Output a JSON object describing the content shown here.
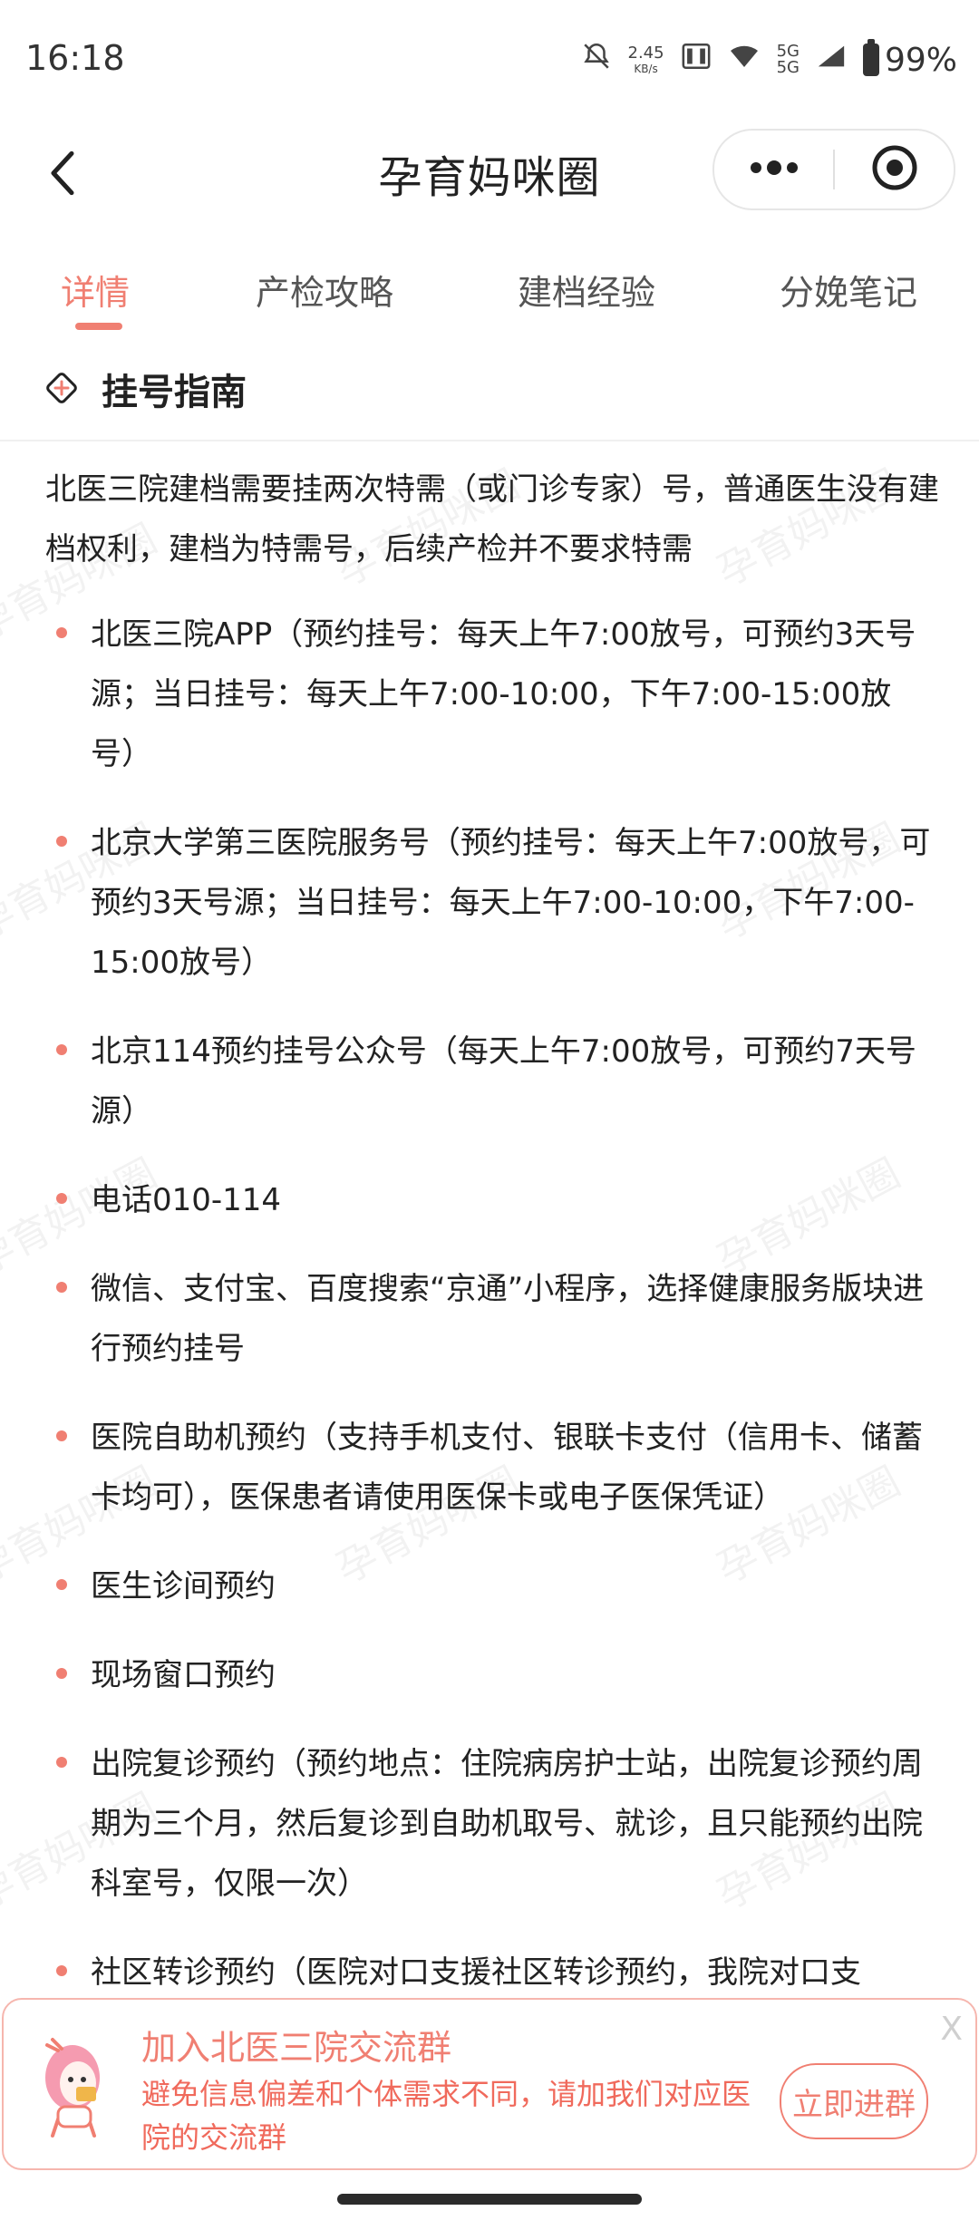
{
  "status_bar": {
    "time": "16:18",
    "net_speed": "2.45",
    "net_unit": "KB/s",
    "sig1": "5G",
    "sig2": "5G",
    "battery": "99%"
  },
  "header": {
    "title": "孕育妈咪圈"
  },
  "tabs": [
    {
      "label": "详情",
      "active": true
    },
    {
      "label": "产检攻略",
      "active": false
    },
    {
      "label": "建档经验",
      "active": false
    },
    {
      "label": "分娩笔记",
      "active": false
    }
  ],
  "section": {
    "title": "挂号指南"
  },
  "content": {
    "intro": "北医三院建档需要挂两次特需（或门诊专家）号，普通医生没有建档权利，建档为特需号，后续产检并不要求特需",
    "items": [
      "北医三院APP（预约挂号：每天上午7:00放号，可预约3天号源；当日挂号：每天上午7:00-10:00，下午7:00-15:00放号）",
      "北京大学第三医院服务号（预约挂号：每天上午7:00放号，可预约3天号源；当日挂号：每天上午7:00-10:00，下午7:00-15:00放号）",
      "北京114预约挂号公众号（每天上午7:00放号，可预约7天号源）",
      "电话010-114",
      "微信、支付宝、百度搜索“京通”小程序，选择健康服务版块进行预约挂号",
      "医院自助机预约（支持手机支付、银联卡支付（信用卡、储蓄卡均可），医保患者请使用医保卡或电子医保凭证）",
      "医生诊间预约",
      "现场窗口预约",
      "出院复诊预约（预约地点：住院病房护士站，出院复诊预约周期为三个月，然后复诊到自助机取号、就诊，且只能预约出院科室号，仅限一次）",
      "社区转诊预约（医院对口支援社区转诊预约，我院对口支"
    ],
    "watermark": "孕育妈咪圈"
  },
  "banner": {
    "title": "加入北医三院交流群",
    "desc": "避免信息偏差和个体需求不同，请加我们对应医院的交流群",
    "button": "立即进群",
    "close": "X"
  },
  "colors": {
    "accent": "#f07f72"
  }
}
